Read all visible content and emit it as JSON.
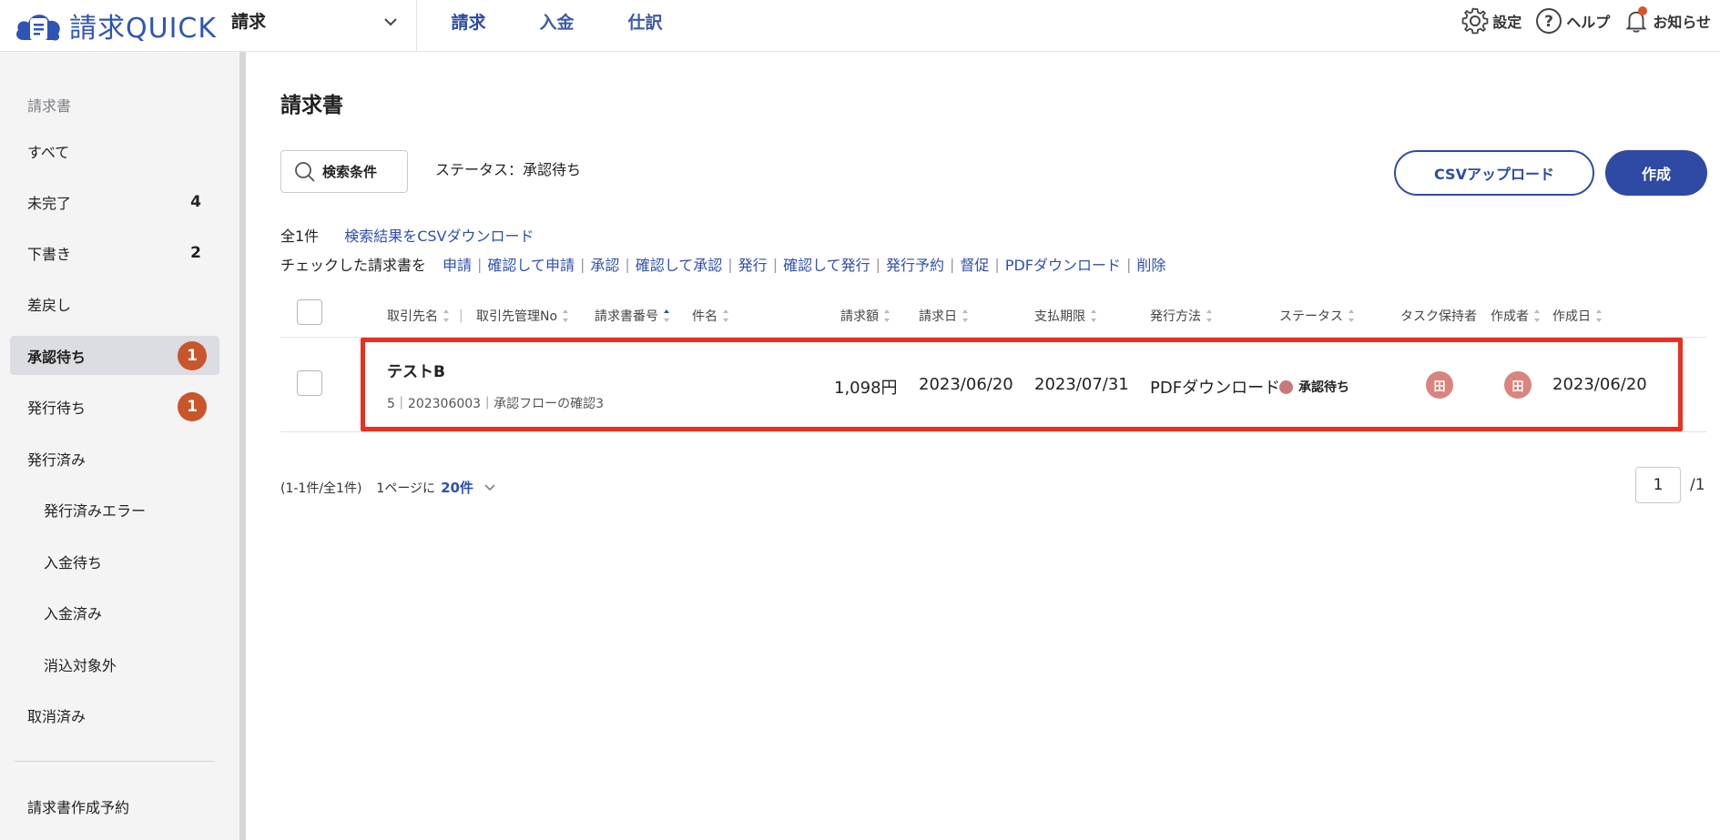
{
  "header": {
    "logo_text": "請求QUICK",
    "app_select": "請求",
    "nav_tabs": [
      "請求",
      "入金",
      "仕訳"
    ],
    "settings": "設定",
    "help": "ヘルプ",
    "notifications": "お知らせ"
  },
  "sidebar": {
    "heading": "請求書",
    "items": [
      {
        "label": "すべて",
        "count": ""
      },
      {
        "label": "未完了",
        "count": "4"
      },
      {
        "label": "下書き",
        "count": "2"
      },
      {
        "label": "差戻し",
        "count": ""
      },
      {
        "label": "承認待ち",
        "badge": "1"
      },
      {
        "label": "発行待ち",
        "badge": "1"
      },
      {
        "label": "発行済み"
      },
      {
        "label": "発行済みエラー"
      },
      {
        "label": "入金待ち"
      },
      {
        "label": "入金済み"
      },
      {
        "label": "消込対象外"
      },
      {
        "label": "取消済み"
      },
      {
        "label": "請求書作成予約"
      }
    ]
  },
  "main": {
    "title": "請求書",
    "search_button": "検索条件",
    "status_filter": "ステータス：承認待ち",
    "csv_upload": "CSVアップロード",
    "create": "作成",
    "total_count": "全1件",
    "csv_download": "検索結果をCSVダウンロード",
    "checked_lead": "チェックした請求書を",
    "actions": [
      "申請",
      "確認して申請",
      "承認",
      "確認して承認",
      "発行",
      "確認して発行",
      "発行予約",
      "督促",
      "PDFダウンロード",
      "削除"
    ]
  },
  "table": {
    "columns": [
      "取引先名",
      "取引先管理No",
      "請求書番号",
      "件名",
      "請求額",
      "請求日",
      "支払期限",
      "発行方法",
      "ステータス",
      "タスク保持者",
      "作成者",
      "作成日"
    ],
    "rows": [
      {
        "title": "テストB",
        "meta": "5｜202306003｜承認フローの確認3",
        "amount": "1,098円",
        "invoice_date": "2023/06/20",
        "due_date": "2023/07/31",
        "method": "PDFダウンロード",
        "status": "承認待ち",
        "task_holder": "田",
        "creator": "田",
        "created_date": "2023/06/20"
      }
    ]
  },
  "pagination": {
    "range": "(1-1件/全1件)",
    "per_page_label": "1ページに",
    "per_page_value": "20件",
    "current_page": "1",
    "total_pages": "/1"
  },
  "colors": {
    "brand": "#2e4aa3",
    "badge": "#c9552c",
    "highlight": "#e8301f",
    "status_dot": "#c9797a"
  }
}
